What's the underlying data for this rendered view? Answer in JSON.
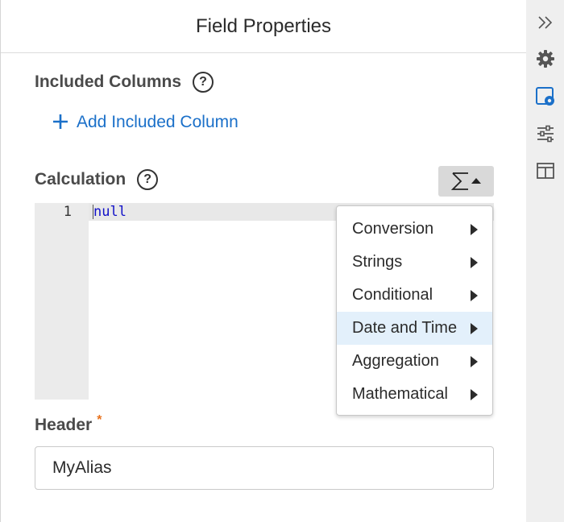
{
  "panel": {
    "title": "Field Properties"
  },
  "included_columns": {
    "label": "Included Columns",
    "help": "?",
    "add_label": "Add Included Column",
    "add_icon": "plus-icon"
  },
  "calculation": {
    "label": "Calculation",
    "help": "?",
    "function_button_icon": "sigma-icon",
    "lines": [
      {
        "number": "1",
        "text": "null"
      }
    ]
  },
  "function_menu": {
    "items": [
      {
        "label": "Conversion",
        "active": false
      },
      {
        "label": "Strings",
        "active": false
      },
      {
        "label": "Conditional",
        "active": false
      },
      {
        "label": "Date and Time",
        "active": true
      },
      {
        "label": "Aggregation",
        "active": false
      },
      {
        "label": "Mathematical",
        "active": false
      }
    ]
  },
  "header": {
    "label": "Header",
    "required_mark": "*",
    "value": "MyAlias"
  },
  "sidebar": {
    "icons": [
      "collapse-chevron-icon",
      "gear-icon",
      "field-settings-icon",
      "sliders-icon",
      "layout-icon"
    ],
    "active_index": 2
  },
  "colors": {
    "accent": "#1b70c9",
    "required": "#e8711c",
    "menu_highlight": "#e3f0fb",
    "code_keyword": "#1010c8"
  }
}
